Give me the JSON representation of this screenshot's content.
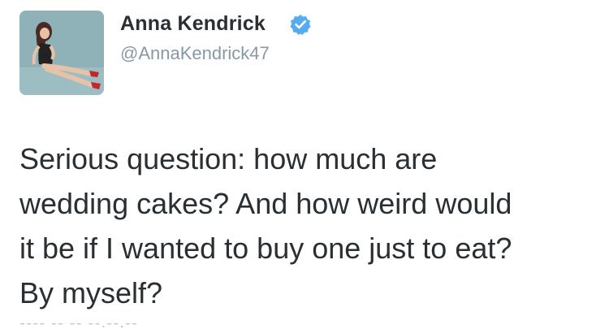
{
  "tweet": {
    "display_name": "Anna Kendrick",
    "handle": "@AnnaKendrick47",
    "verified": true,
    "verified_icon": "verified-badge-icon",
    "avatar_icon": "profile-photo",
    "text": "Serious question: how much are\nwedding cakes? And how weird would\nit be if I wanted to buy one just to eat?\nBy myself?"
  },
  "colors": {
    "name": "#292f33",
    "handle": "#8899a6",
    "verified": "#55acee",
    "text": "#292f33",
    "avatar_bg": "#8fb2b8"
  }
}
